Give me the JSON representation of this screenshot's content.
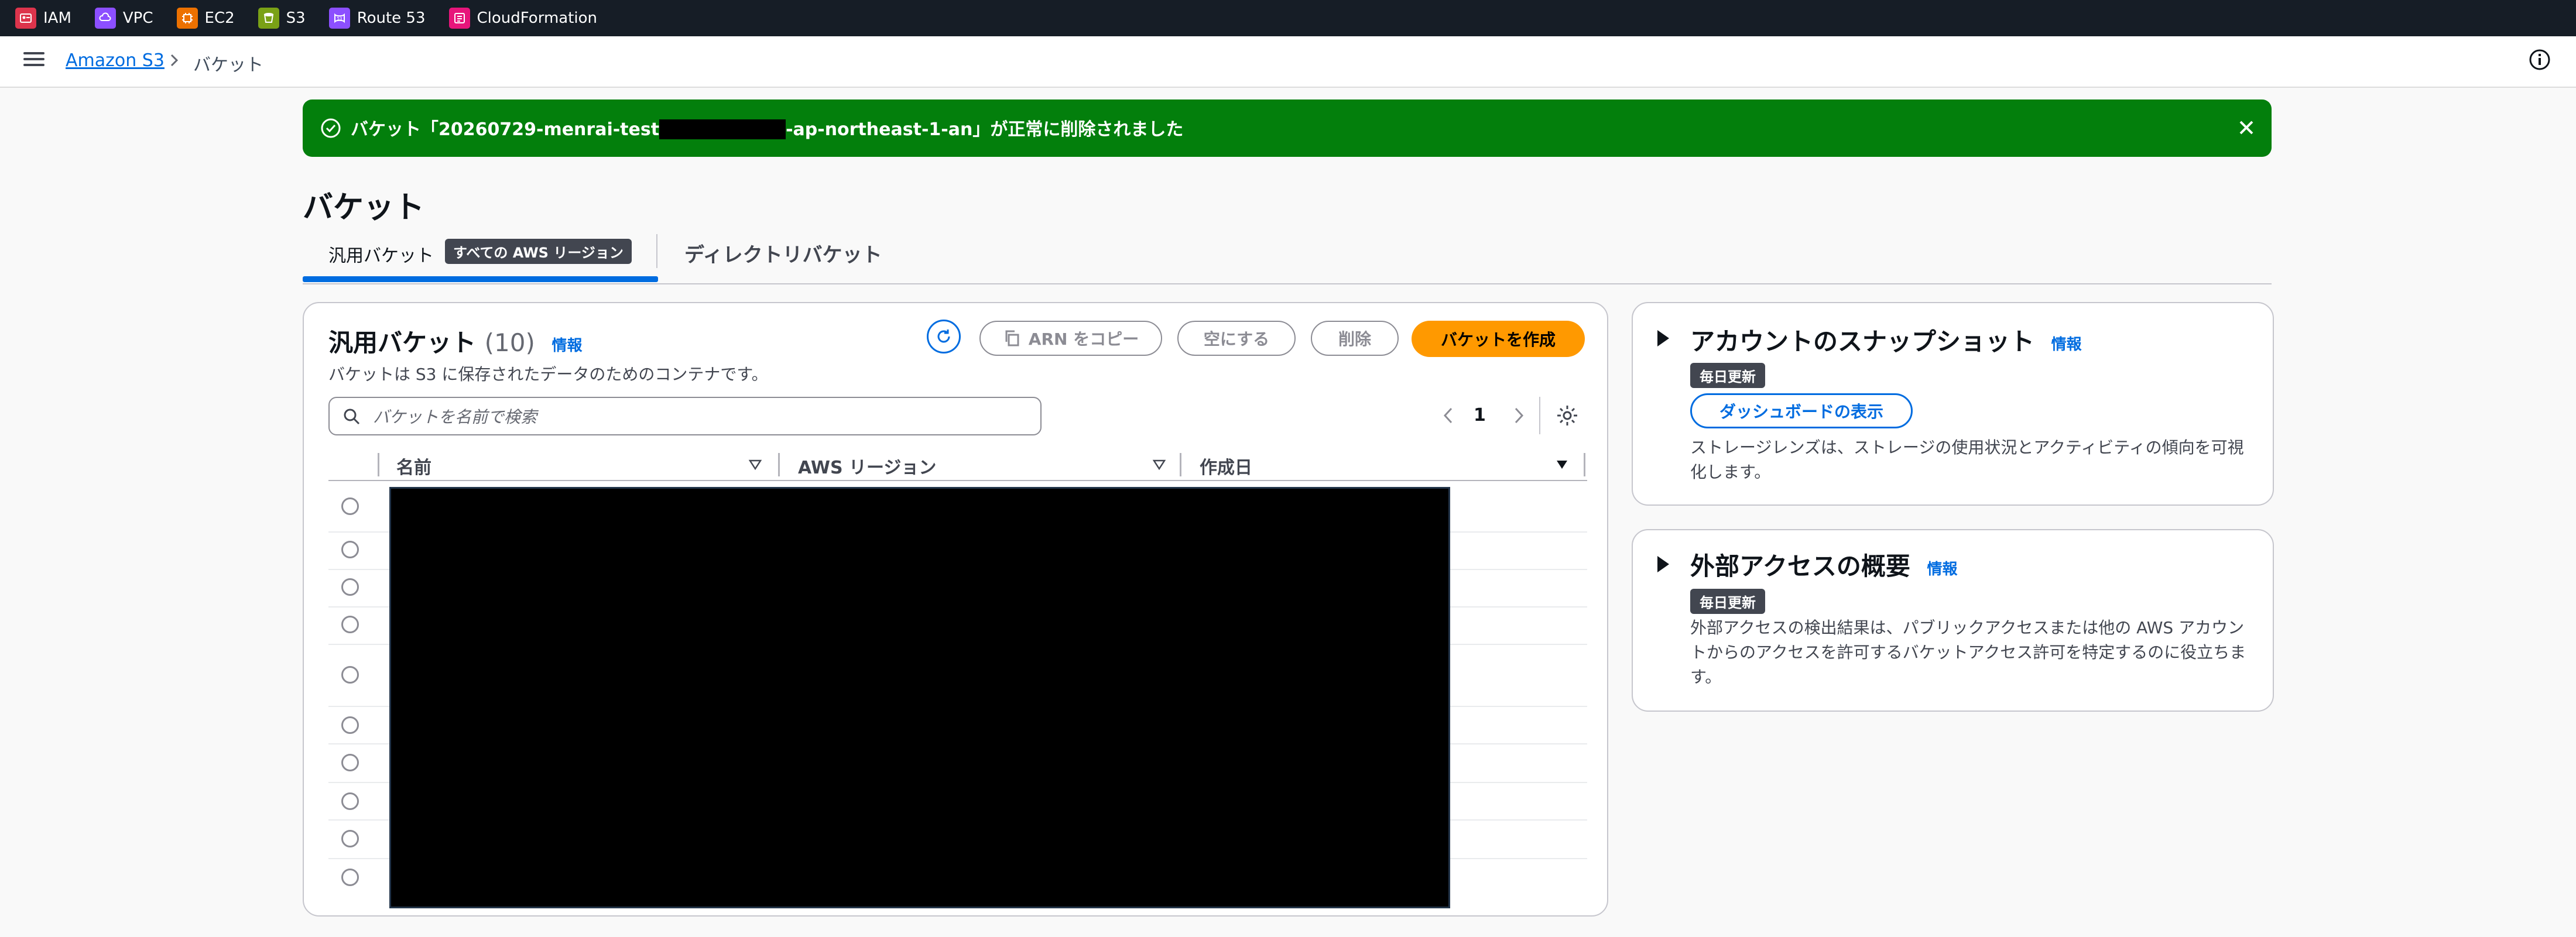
{
  "service_bar": {
    "items": [
      {
        "label": "IAM",
        "color": "#dd344c",
        "icon": "iam-icon"
      },
      {
        "label": "VPC",
        "color": "#8c4fff",
        "icon": "vpc-icon"
      },
      {
        "label": "EC2",
        "color": "#ed7100",
        "icon": "ec2-icon"
      },
      {
        "label": "S3",
        "color": "#7aa116",
        "icon": "s3-icon"
      },
      {
        "label": "Route 53",
        "color": "#8c4fff",
        "icon": "route53-icon"
      },
      {
        "label": "CloudFormation",
        "color": "#e7157b",
        "icon": "cloudformation-icon"
      }
    ]
  },
  "breadcrumb": {
    "root": "Amazon S3",
    "current": "バケット"
  },
  "flash": {
    "text_before": "バケット「20260729-menrai-test",
    "text_after": "-ap-northeast-1-an」が正常に削除されました",
    "color": "#037f0c"
  },
  "page": {
    "title": "バケット"
  },
  "tabs": {
    "general": "汎用バケット",
    "general_badge": "すべての AWS リージョン",
    "directory": "ディレクトリバケット"
  },
  "buckets": {
    "title": "汎用バケット",
    "count": "(10)",
    "info": "情報",
    "description": "バケットは S3 に保存されたデータのためのコンテナです。",
    "copy_arn": "ARN をコピー",
    "empty": "空にする",
    "delete": "削除",
    "create": "バケットを作成",
    "search_placeholder": "バケットを名前で検索",
    "page": "1",
    "columns": [
      "名前",
      "AWS リージョン",
      "作成日"
    ],
    "row_count": 10
  },
  "snapshot": {
    "title": "アカウントのスナップショット",
    "info": "情報",
    "badge": "毎日更新",
    "button": "ダッシュボードの表示",
    "description": "ストレージレンズは、ストレージの使用状況とアクティビティの傾向を可視化します。"
  },
  "external": {
    "title": "外部アクセスの概要",
    "info": "情報",
    "badge": "毎日更新",
    "description": "外部アクセスの検出結果は、パブリックアクセスまたは他の AWS アカウントからのアクセスを許可するバケットアクセス許可を特定するのに役立ちます。"
  }
}
